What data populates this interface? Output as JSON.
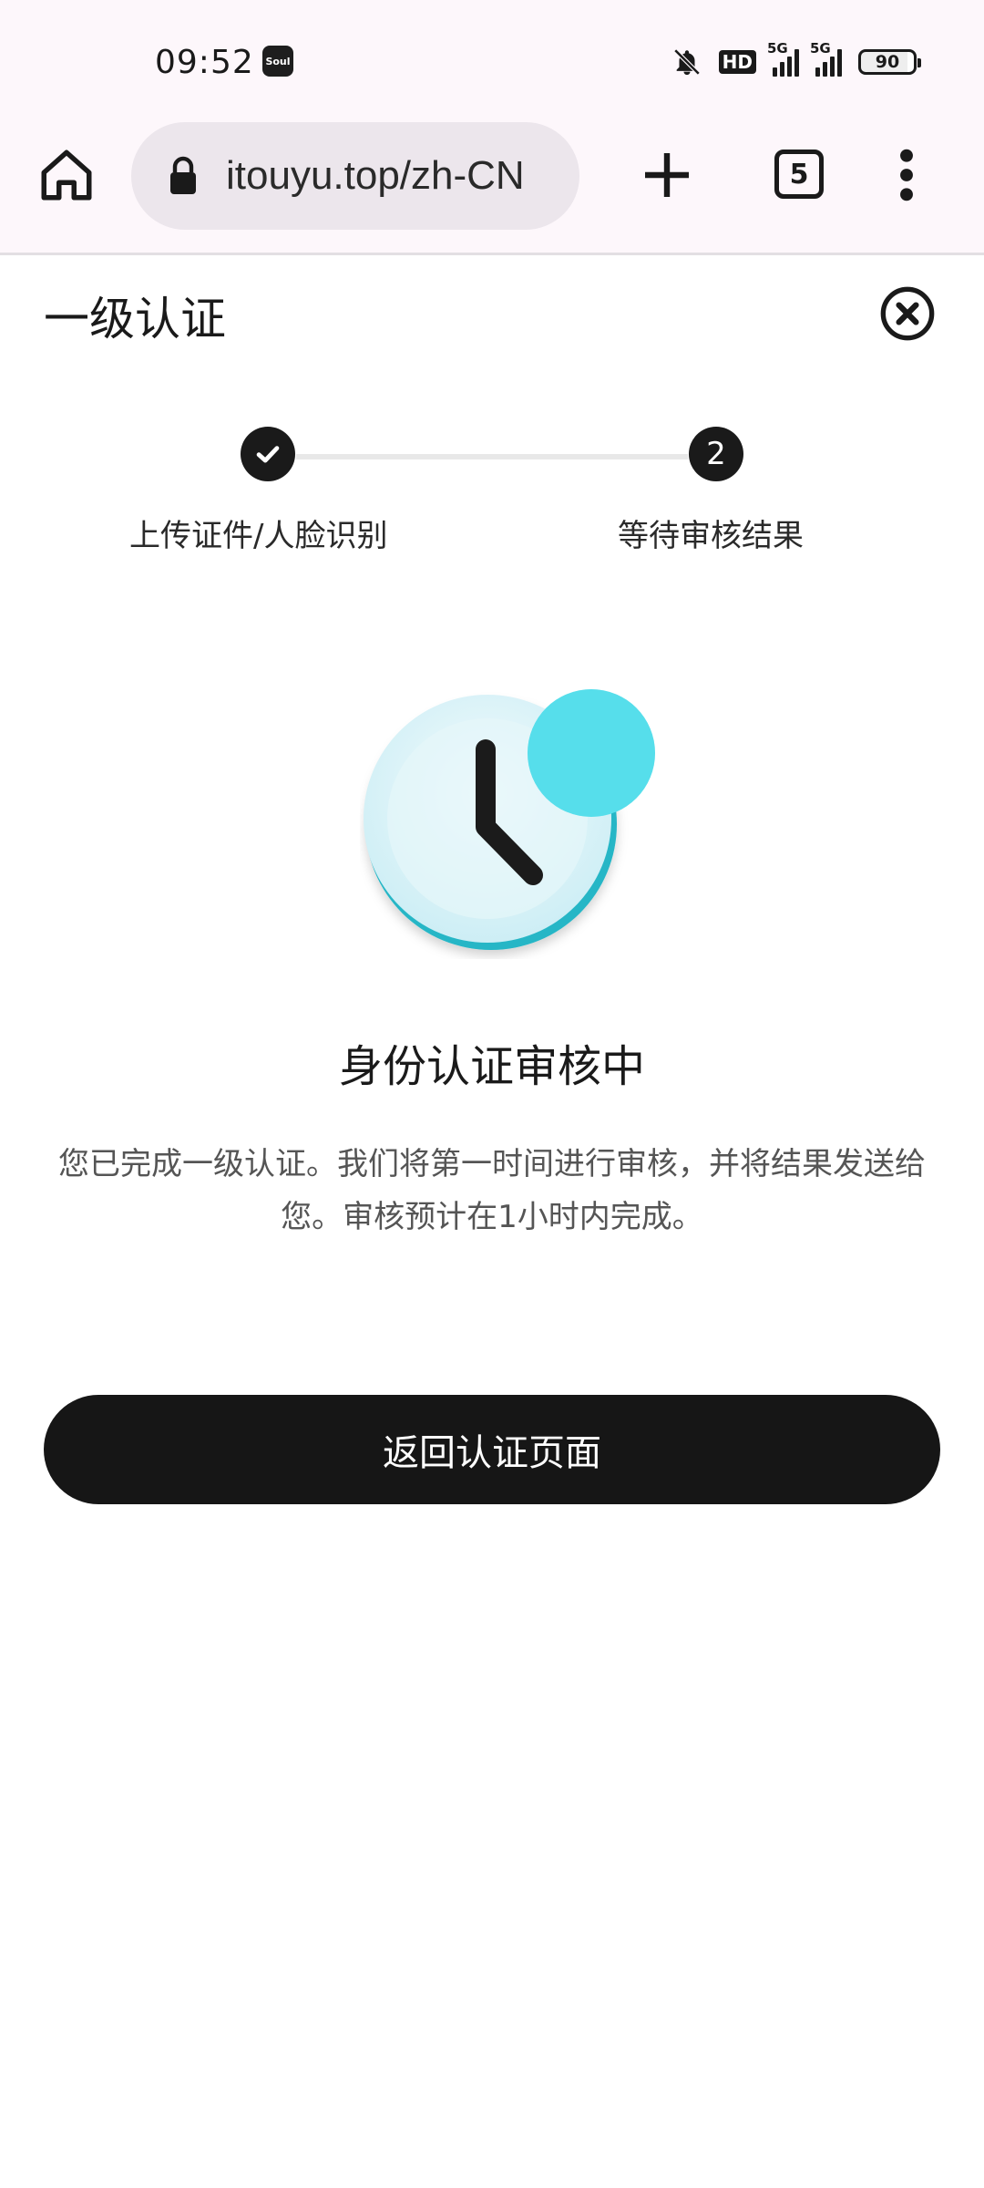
{
  "status_bar": {
    "time": "09:52",
    "app_icon_label": "Soul",
    "hd_label": "HD",
    "signal1_label": "5G",
    "signal2_label": "5G",
    "battery": "90"
  },
  "browser": {
    "url": "itouyu.top/zh-CN",
    "tab_count": "5"
  },
  "page": {
    "title": "一级认证",
    "steps": [
      {
        "label": "上传证件/人脸识别",
        "state": "done"
      },
      {
        "label": "等待审核结果",
        "number": "2",
        "state": "current"
      }
    ],
    "status_title": "身份认证审核中",
    "status_desc": "您已完成一级认证。我们将第一时间进行审核，并将结果发送给您。审核预计在1小时内完成。",
    "back_button": "返回认证页面"
  },
  "colors": {
    "accent_dark": "#161616",
    "clock_teal": "#1ed6e6",
    "clock_face": "#d9f3f7"
  },
  "icons": [
    "home-icon",
    "lock-icon",
    "plus-icon",
    "tabs-icon",
    "more-vert-icon",
    "close-circle-icon",
    "check-icon",
    "clock-icon",
    "bell-off-icon",
    "battery-icon"
  ]
}
